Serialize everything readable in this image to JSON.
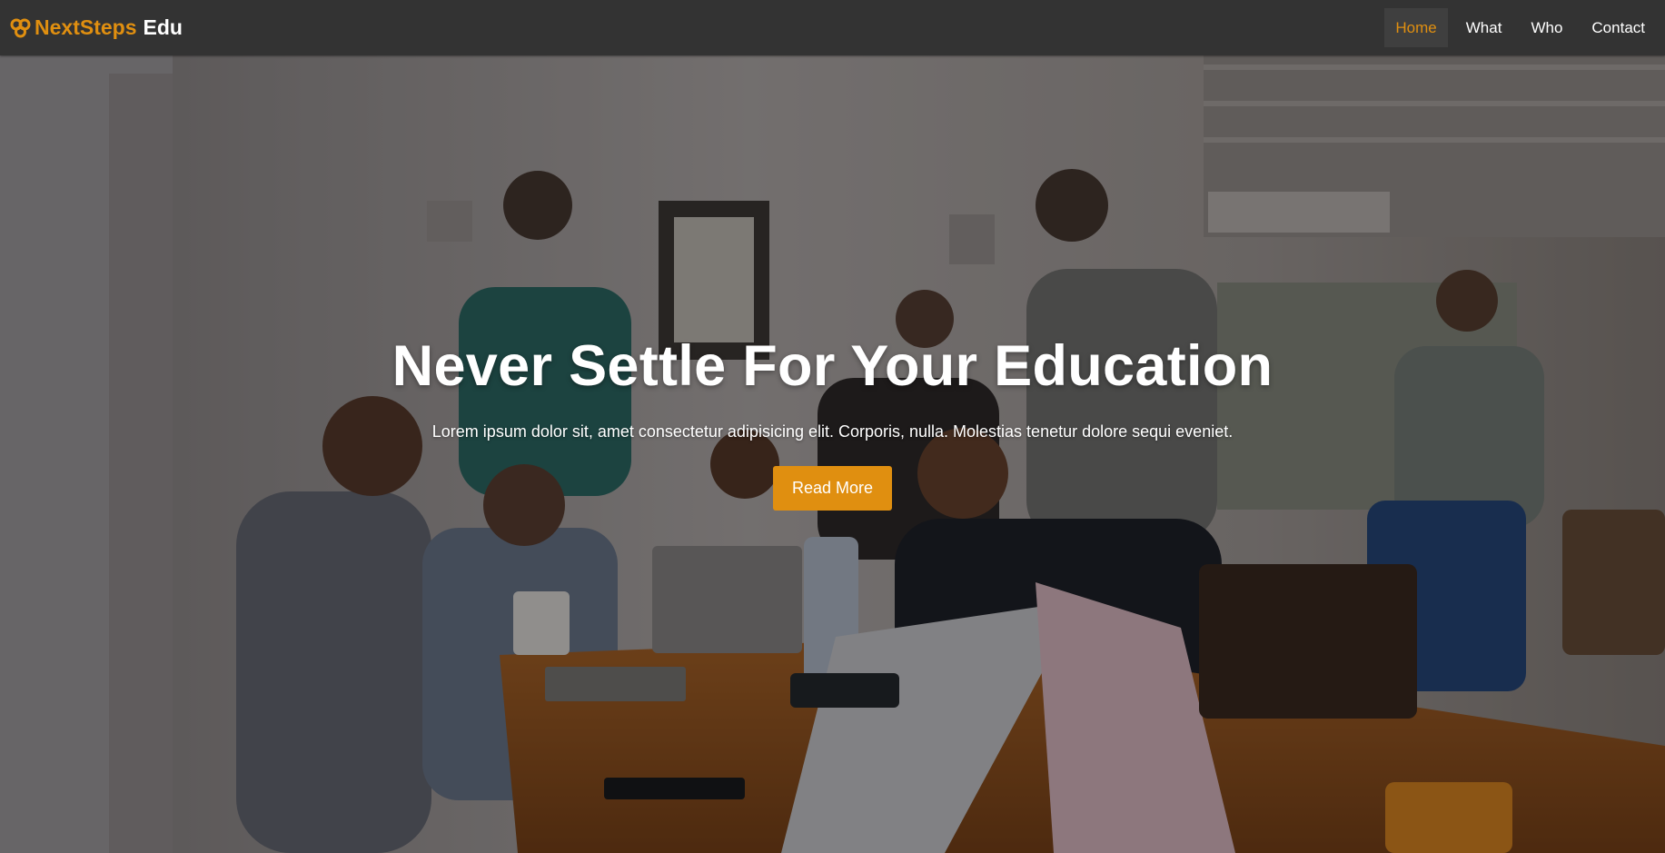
{
  "colors": {
    "accent": "#e08f10",
    "navbar_bg": "#333333",
    "nav_active_bg": "#3f3f3f",
    "text_light": "#ffffff"
  },
  "navbar": {
    "brand": {
      "icon": "infinity-knot-icon",
      "primary": "NextSteps",
      "secondary": "Edu"
    },
    "links": [
      {
        "label": "Home",
        "active": true
      },
      {
        "label": "What",
        "active": false
      },
      {
        "label": "Who",
        "active": false
      },
      {
        "label": "Contact",
        "active": false
      }
    ]
  },
  "hero": {
    "background": "photo-students-gathered-around-laptops",
    "title": "Never Settle For Your Education",
    "text": "Lorem ipsum dolor sit, amet consectetur adipisicing elit. Corporis, nulla. Molestias tenetur dolore sequi eveniet.",
    "button_label": "Read More"
  }
}
